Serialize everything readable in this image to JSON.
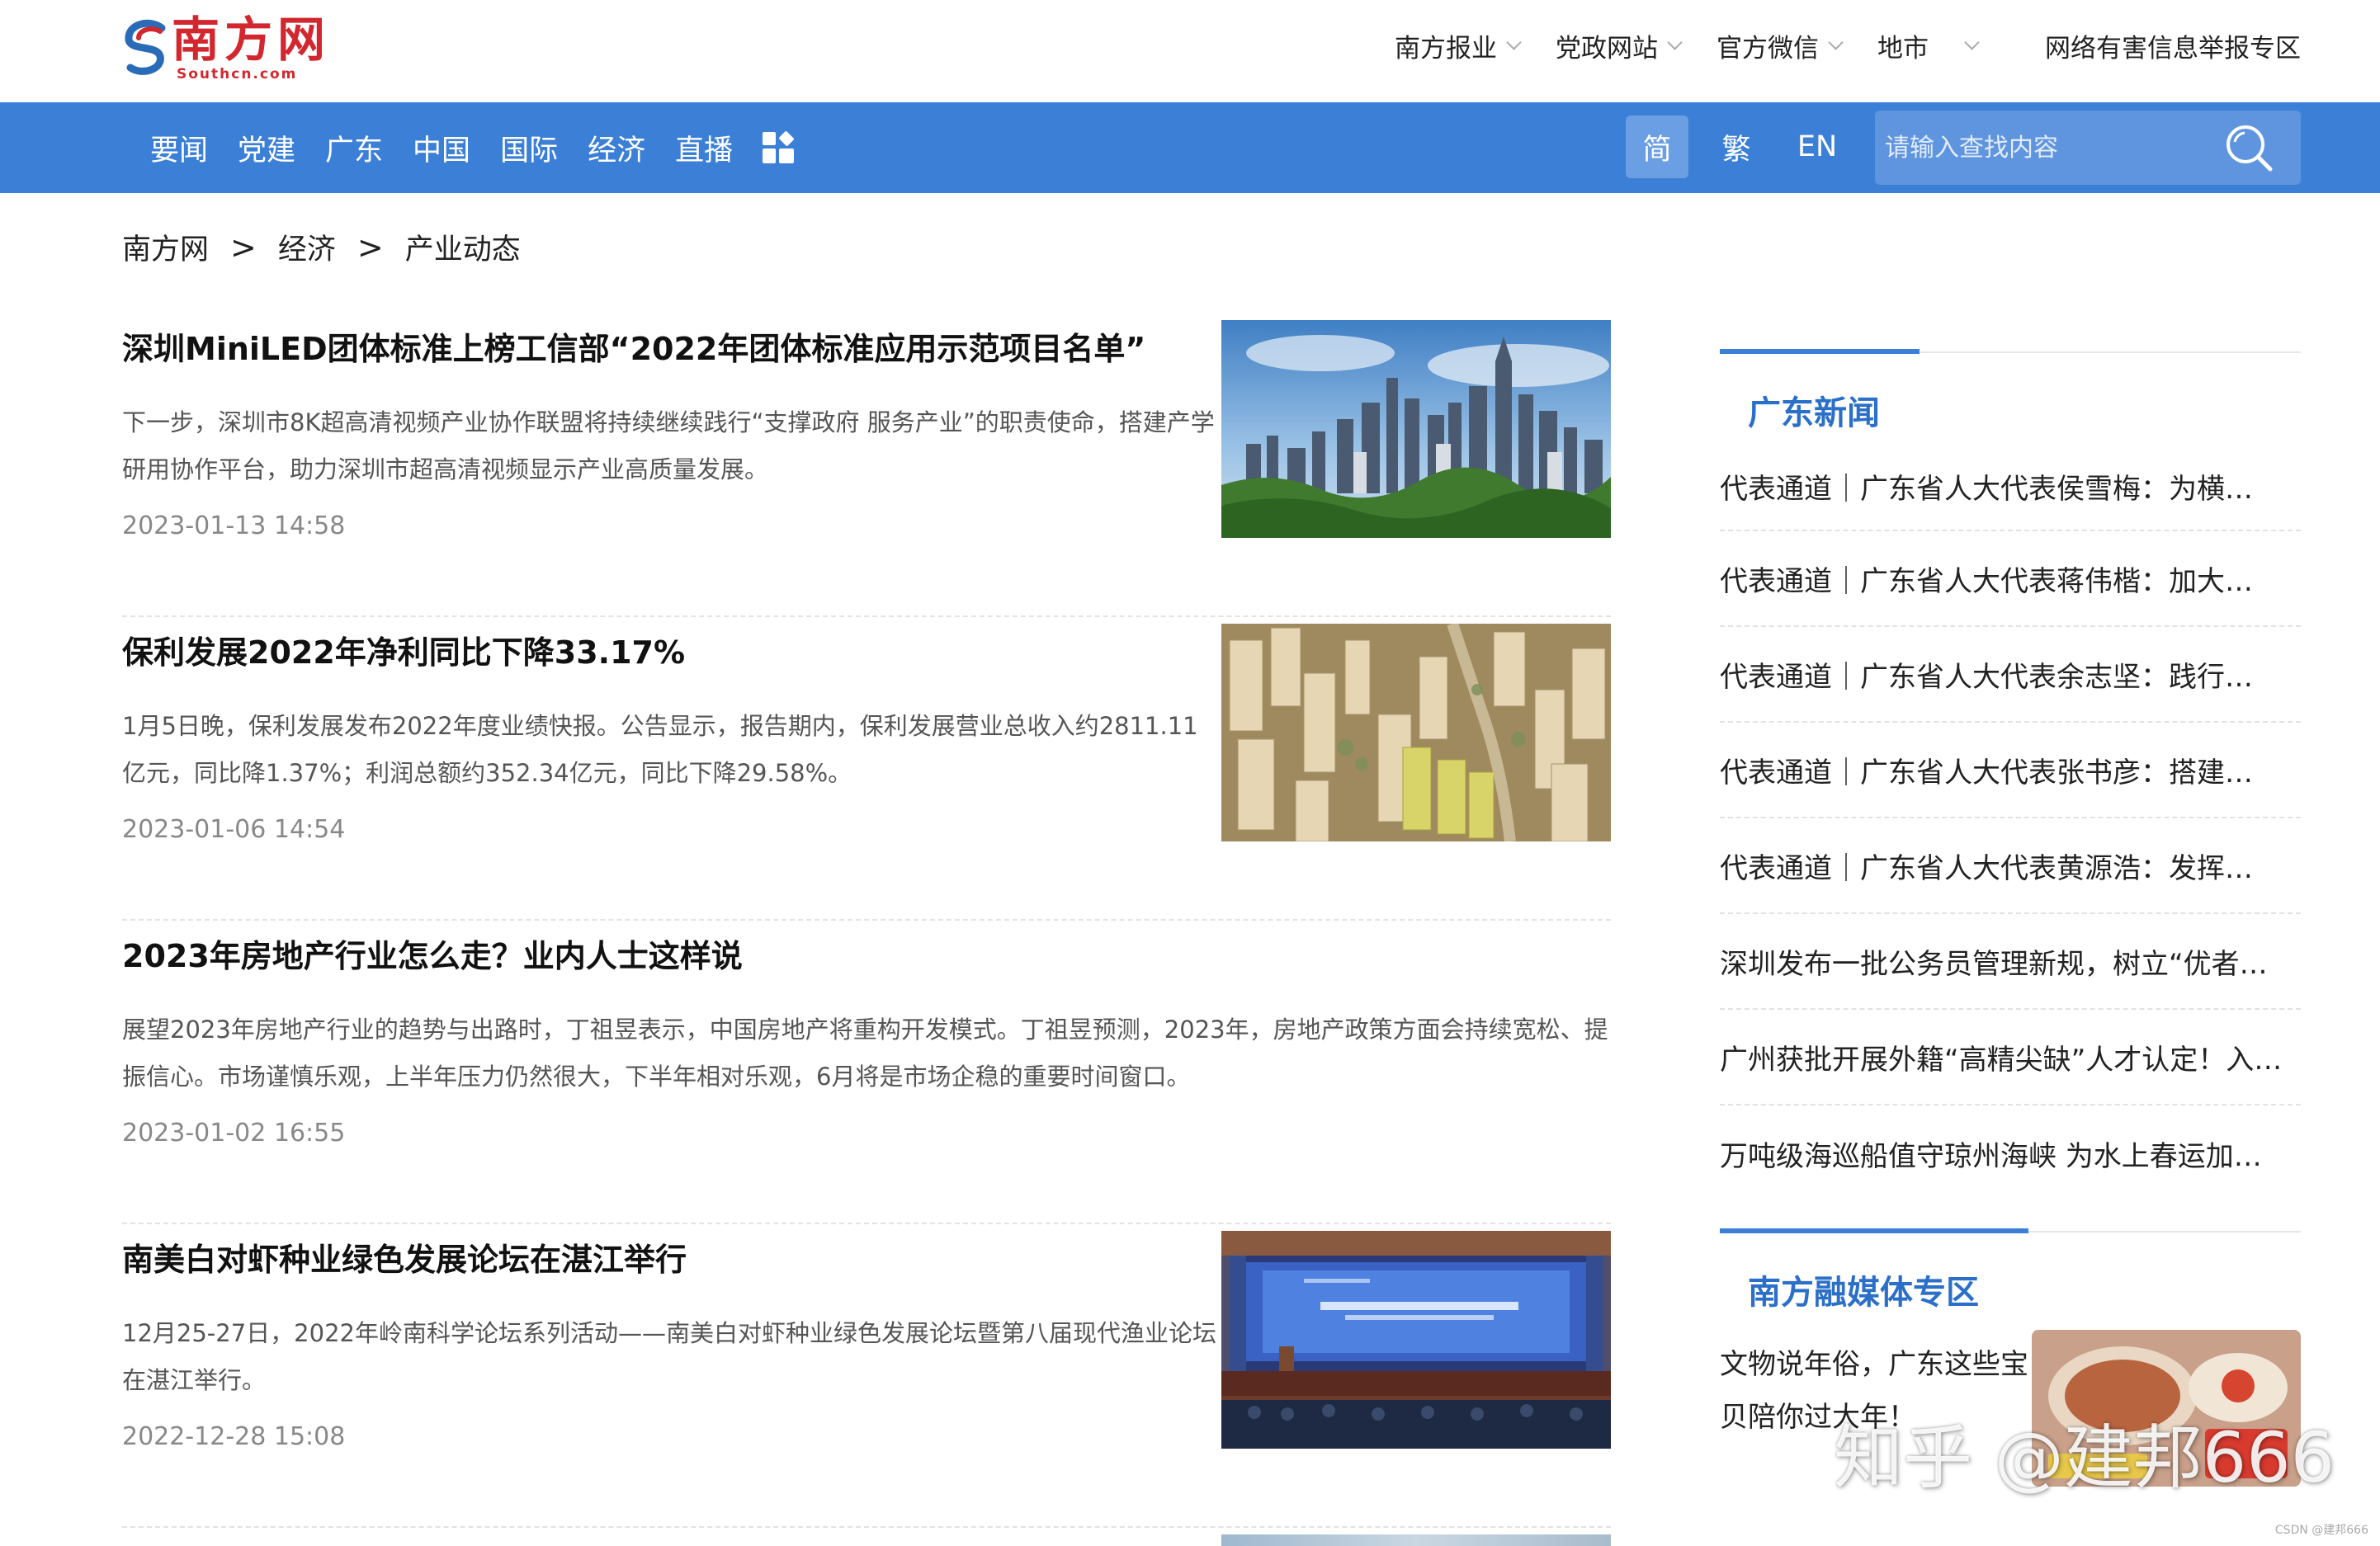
{
  "header": {
    "logo_text": "南方网",
    "logo_sub": "Southcn.com",
    "top_links": [
      {
        "label": "南方报业",
        "dropdown": true
      },
      {
        "label": "党政网站",
        "dropdown": true
      },
      {
        "label": "官方微信",
        "dropdown": true
      },
      {
        "label": "地市",
        "dropdown": true
      },
      {
        "label": "网络有害信息举报专区",
        "dropdown": false
      }
    ]
  },
  "nav": {
    "items": [
      "要闻",
      "党建",
      "广东",
      "中国",
      "国际",
      "经济",
      "直播"
    ],
    "lang": {
      "simplified": "简",
      "traditional": "繁",
      "english": "EN"
    },
    "search_placeholder": "请输入查找内容",
    "accent_color": "#3b7fd6"
  },
  "breadcrumb": {
    "items": [
      "南方网",
      "经济",
      "产业动态"
    ],
    "separator": ">"
  },
  "articles": [
    {
      "title": "深圳MiniLED团体标准上榜工信部“2022年团体标准应用示范项目名单”",
      "summary": "下一步，深圳市8K超高清视频产业协作联盟将持续继续践行“支撑政府 服务产业”的职责使命，搭建产学研用协作平台，助力深圳市超高清视频显示产业高质量发展。",
      "date": "2023-01-13 14:58",
      "thumb": "city-skyline-image"
    },
    {
      "title": "保利发展2022年净利同比下降33.17%",
      "summary": "1月5日晚，保利发展发布2022年度业绩快报。公告显示，报告期内，保利发展营业总收入约2811.11亿元，同比降1.37%；利润总额约352.34亿元，同比下降29.58%。",
      "date": "2023-01-06 14:54",
      "thumb": "building-model-image"
    },
    {
      "title": "2023年房地产行业怎么走？业内人士这样说",
      "summary": "展望2023年房地产行业的趋势与出路时，丁祖昱表示，中国房地产将重构开发模式。丁祖昱预测，2023年，房地产政策方面会持续宽松、提振信心。市场谨慎乐观，上半年压力仍然很大，下半年相对乐观，6月将是市场企稳的重要时间窗口。",
      "date": "2023-01-02 16:55",
      "thumb": ""
    },
    {
      "title": "南美白对虾种业绿色发展论坛在湛江举行",
      "summary": "12月25-27日，2022年岭南科学论坛系列活动——南美白对虾种业绿色发展论坛暨第八届现代渔业论坛在湛江举行。",
      "date": "2022-12-28 15:08",
      "thumb": "conference-hall-image"
    }
  ],
  "sidebar": {
    "guangdong_news": {
      "title": "广东新闻",
      "items": [
        "代表通道｜广东省人大代表侯雪梅：为横…",
        "代表通道｜广东省人大代表蒋伟楷：加大…",
        "代表通道｜广东省人大代表余志坚：践行…",
        "代表通道｜广东省人大代表张书彦：搭建…",
        "代表通道｜广东省人大代表黄源浩：发挥…",
        "深圳发布一批公务员管理新规，树立“优者…",
        "广州获批开展外籍“高精尖缺”人才认定！入…",
        "万吨级海巡船值守琼州海峡 为水上春运加…"
      ]
    },
    "media_zone": {
      "title": "南方融媒体专区",
      "item_text": "文物说年俗，广东这些宝贝陪你过大年！"
    }
  },
  "watermark": {
    "text": "知乎 @建邦666",
    "csdn": "CSDN @建邦666"
  }
}
